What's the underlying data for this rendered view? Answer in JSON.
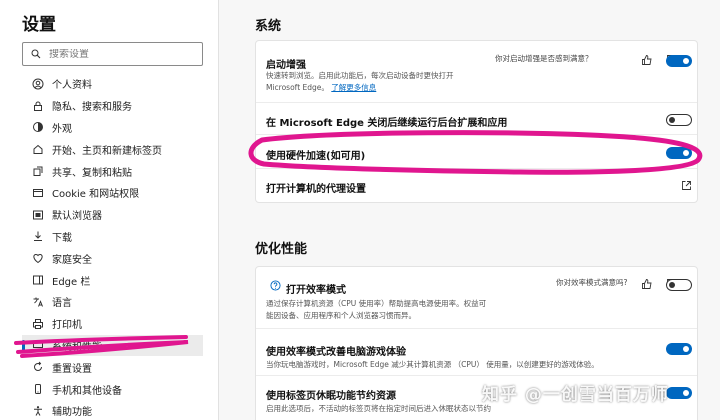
{
  "sidebar": {
    "title": "设置",
    "search": {
      "placeholder": "搜索设置"
    },
    "items": [
      {
        "label": "个人资料",
        "icon": "profile-icon"
      },
      {
        "label": "隐私、搜索和服务",
        "icon": "lock-icon"
      },
      {
        "label": "外观",
        "icon": "appearance-icon"
      },
      {
        "label": "开始、主页和新建标签页",
        "icon": "home-icon"
      },
      {
        "label": "共享、复制和粘贴",
        "icon": "share-icon"
      },
      {
        "label": "Cookie 和网站权限",
        "icon": "cookie-icon"
      },
      {
        "label": "默认浏览器",
        "icon": "browser-icon"
      },
      {
        "label": "下载",
        "icon": "download-icon"
      },
      {
        "label": "家庭安全",
        "icon": "family-icon"
      },
      {
        "label": "Edge 栏",
        "icon": "edge-bar-icon"
      },
      {
        "label": "语言",
        "icon": "language-icon"
      },
      {
        "label": "打印机",
        "icon": "printer-icon"
      },
      {
        "label": "系统和性能",
        "icon": "system-icon"
      },
      {
        "label": "重置设置",
        "icon": "reset-icon"
      },
      {
        "label": "手机和其他设备",
        "icon": "phone-icon"
      },
      {
        "label": "辅助功能",
        "icon": "accessibility-icon"
      }
    ]
  },
  "system": {
    "title": "系统",
    "startup_boost": {
      "title": "启动增强",
      "desc_line1": "快速转到浏览。启用此功能后，每次启动设备时更快打开",
      "desc_line2": "Microsoft Edge。",
      "link": "了解更多信息",
      "feedback": "你对启动增强是否感到满意？",
      "toggle": "on"
    },
    "background_apps": {
      "title": "在 Microsoft Edge 关闭后继续运行后台扩展和应用",
      "toggle": "off"
    },
    "hardware_accel": {
      "title": "使用硬件加速(如可用)",
      "toggle": "on"
    },
    "proxy": {
      "title": "打开计算机的代理设置",
      "icon": "external-link-icon"
    }
  },
  "performance": {
    "title": "优化性能",
    "efficiency_mode": {
      "title": "打开效率模式",
      "feedback": "你对效率模式满意吗?",
      "desc_line1": "通过保存计算机资源（CPU 使用率）帮助提高电源使用率。权益可",
      "desc_line2": "能因设备、应用程序和个人浏览器习惯而异。",
      "toggle": "off",
      "icon": "help-icon"
    },
    "gaming": {
      "title": "使用效率模式改善电脑游戏体验",
      "desc": "当你玩电脑游戏时，Microsoft Edge 减少其计算机资源 （CPU） 使用量，以创建更好的游戏体验。",
      "toggle": "on"
    },
    "sleeping_tabs": {
      "title": "使用标签页休眠功能节约资源",
      "desc": "启用此选项后，不活动的标签页将在指定时间后进入休眠状态以节约",
      "toggle": "on"
    }
  },
  "watermark": "知乎 @一创雪当百万师",
  "colors": {
    "accent": "#0067c0",
    "annotation": "#e0168f"
  }
}
